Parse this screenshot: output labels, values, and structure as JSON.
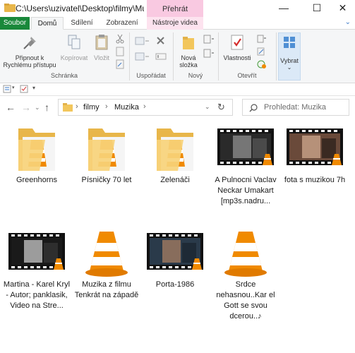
{
  "window": {
    "title": "C:\\Users\\uzivatel\\Desktop\\filmy\\Muz...",
    "context_tab": "Přehrát",
    "minimize": "—",
    "maximize": "☐",
    "close": "✕"
  },
  "tabs": {
    "file": "Soubor",
    "home": "Domů",
    "share": "Sdílení",
    "view": "Zobrazení",
    "video_tools": "Nástroje videa"
  },
  "ribbon": {
    "pin_line1": "Připnout k",
    "pin_line2": "Rychlému přístupu",
    "copy": "Kopírovat",
    "paste": "Vložit",
    "group_clipboard": "Schránka",
    "group_organize": "Uspořádat",
    "new_folder_line1": "Nová",
    "new_folder_line2": "složka",
    "group_new": "Nový",
    "properties": "Vlastnosti",
    "group_open": "Otevřít",
    "select": "Vybrat"
  },
  "nav": {
    "back": "←",
    "forward": "→",
    "up": "↑",
    "crumbs": [
      "filmy",
      "Muzika"
    ],
    "refresh": "↻",
    "search_placeholder": "Prohledat: Muzika"
  },
  "files": [
    {
      "name": "Greenhorns",
      "type": "folder"
    },
    {
      "name": "Písničky 70 let",
      "type": "folder"
    },
    {
      "name": "Zelenáči",
      "type": "folder"
    },
    {
      "name": "A Pulnocni Vaclav Neckar Umakart [mp3s.nadru...",
      "type": "video"
    },
    {
      "name": "fota s muzikou 7h",
      "type": "video"
    },
    {
      "name": "Martina - Karel Kryl - Autor; panklasik, Video na Stre...",
      "type": "video"
    },
    {
      "name": "Muzika z filmu Tenkrát na západě",
      "type": "vlc"
    },
    {
      "name": "Porta-1986",
      "type": "video"
    },
    {
      "name": "Srdce nehasnou..Kar el Gott se svou dcerou..♪",
      "type": "vlc"
    }
  ],
  "colors": {
    "file_tab": "#19883a",
    "context_tab": "#f9c9e1",
    "folder": "#f2c65c",
    "vlc_orange": "#f08a00"
  }
}
